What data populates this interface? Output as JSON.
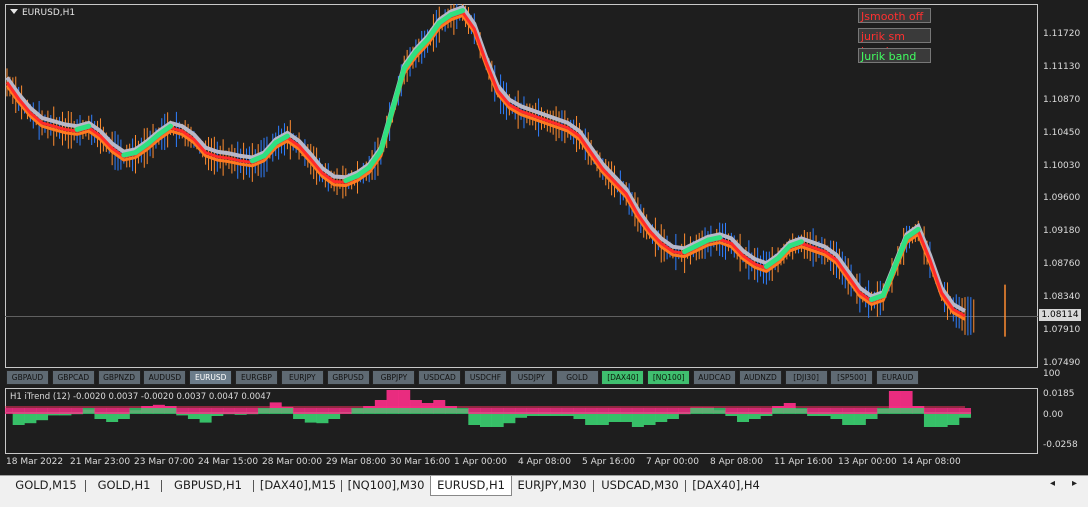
{
  "window": {
    "symbol": "EURUSD,H1"
  },
  "legend": [
    {
      "label": "Jsmooth off",
      "color": "#ff3030",
      "bg": "#3a3a3a"
    },
    {
      "label": "jurik sm band",
      "color": "#ff3030",
      "bg": "#3a3a3a"
    },
    {
      "label": "Jurik band",
      "color": "#40ff60",
      "bg": "#3a3a3a"
    }
  ],
  "price_axis": [
    "1.11720",
    "1.11130",
    "1.10870",
    "1.10450",
    "1.10030",
    "1.09600",
    "1.09180",
    "1.08760",
    "1.08340",
    "1.07910",
    "1.07490"
  ],
  "current_price": "1.08114",
  "symbol_buttons": [
    {
      "label": "GBPAUD",
      "state": "normal"
    },
    {
      "label": "GBPCAD",
      "state": "normal"
    },
    {
      "label": "GBPNZD",
      "state": "normal"
    },
    {
      "label": "AUDUSD",
      "state": "normal"
    },
    {
      "label": "EURUSD",
      "state": "active"
    },
    {
      "label": "EURGBP",
      "state": "normal"
    },
    {
      "label": "EURJPY",
      "state": "normal"
    },
    {
      "label": "GBPUSD",
      "state": "normal"
    },
    {
      "label": "GBPJPY",
      "state": "normal"
    },
    {
      "label": "USDCAD",
      "state": "normal"
    },
    {
      "label": "USDCHF",
      "state": "normal"
    },
    {
      "label": "USDJPY",
      "state": "normal"
    },
    {
      "label": "GOLD",
      "state": "normal"
    },
    {
      "label": "[DAX40]",
      "state": "green"
    },
    {
      "label": "[NQ100]",
      "state": "green"
    },
    {
      "label": "AUDCAD",
      "state": "normal"
    },
    {
      "label": "AUDNZD",
      "state": "normal"
    },
    {
      "label": "[DJI30]",
      "state": "normal"
    },
    {
      "label": "[SP500]",
      "state": "normal"
    },
    {
      "label": "EURAUD",
      "state": "normal"
    }
  ],
  "indicator": {
    "label": "H1  iTrend (12) -0.0020 0.0037 -0.0020 0.0037 0.0047 0.0047",
    "axis": [
      "100",
      "0.0185",
      "0.00",
      "-0.0258"
    ]
  },
  "time_axis": [
    "18 Mar 2022",
    "21 Mar 23:00",
    "23 Mar 07:00",
    "24 Mar 15:00",
    "28 Mar 00:00",
    "29 Mar 08:00",
    "30 Mar 16:00",
    "1 Apr 00:00",
    "4 Apr 08:00",
    "5 Apr 16:00",
    "7 Apr 00:00",
    "8 Apr 08:00",
    "11 Apr 16:00",
    "13 Apr 00:00",
    "14 Apr 08:00"
  ],
  "tabs": [
    {
      "label": "GOLD,M15",
      "active": false
    },
    {
      "label": "GOLD,H1",
      "active": false
    },
    {
      "label": "GBPUSD,H1",
      "active": false
    },
    {
      "label": "[DAX40],M15",
      "active": false
    },
    {
      "label": "[NQ100],M30",
      "active": false
    },
    {
      "label": "EURUSD,H1",
      "active": true
    },
    {
      "label": "EURJPY,M30",
      "active": false
    },
    {
      "label": "USDCAD,M30",
      "active": false
    },
    {
      "label": "[DAX40],H4",
      "active": false
    }
  ],
  "tab_arrows": {
    "left": "◂",
    "right": "▸"
  },
  "colors": {
    "bg": "#1e1e1e",
    "up": "#2f7fff",
    "down": "#ff8c30",
    "band_red": "#ff2a2a",
    "band_orange": "#ff7a20",
    "band_green": "#30e080",
    "band_gray": "#b8b8c8",
    "hist_pink": "#ff2d8a",
    "hist_green": "#3ad070"
  },
  "chart_data": {
    "type": "line",
    "title": "EURUSD,H1",
    "price_series": [
      1.1095,
      1.1075,
      1.1058,
      1.1046,
      1.1042,
      1.1038,
      1.1036,
      1.104,
      1.103,
      1.1015,
      1.1005,
      1.1008,
      1.1018,
      1.103,
      1.104,
      1.1036,
      1.1026,
      1.101,
      1.1005,
      1.1003,
      1.1,
      1.0998,
      1.1004,
      1.102,
      1.1028,
      1.1018,
      1.1002,
      1.0985,
      1.0975,
      1.0974,
      1.098,
      1.099,
      1.101,
      1.106,
      1.111,
      1.113,
      1.1145,
      1.1165,
      1.1175,
      1.118,
      1.116,
      1.112,
      1.1085,
      1.1068,
      1.106,
      1.1055,
      1.105,
      1.1045,
      1.104,
      1.103,
      1.101,
      1.099,
      1.0975,
      1.096,
      1.0935,
      1.0915,
      1.09,
      1.089,
      1.0888,
      1.0895,
      1.0902,
      1.0905,
      1.09,
      1.0885,
      1.0875,
      1.087,
      1.088,
      1.0895,
      1.09,
      1.0895,
      1.089,
      1.088,
      1.086,
      1.084,
      1.083,
      1.0835,
      1.087,
      1.0905,
      1.0915,
      1.088,
      1.084,
      1.082,
      1.0812
    ],
    "ylim": [
      1.0749,
      1.119
    ]
  }
}
